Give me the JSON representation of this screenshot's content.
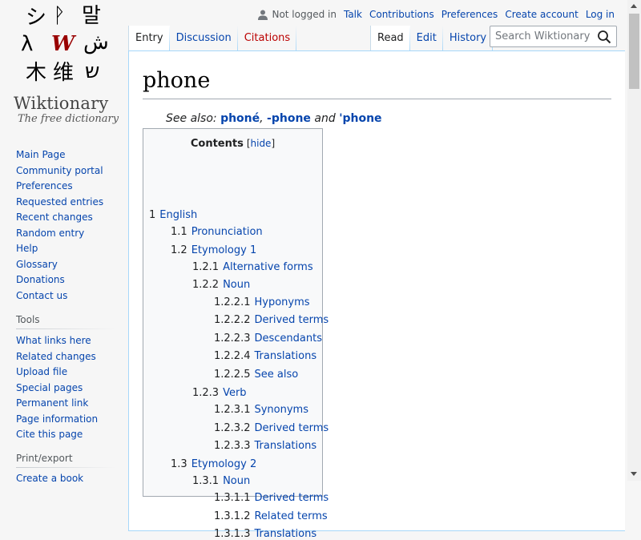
{
  "logo": {
    "glyphs": [
      "シ",
      "ᚹ",
      "말",
      "λ",
      "W",
      "ش",
      "木",
      "维",
      "ש"
    ],
    "title": "Wiktionary",
    "tagline": "The free dictionary"
  },
  "sidebar": {
    "navigation": [
      "Main Page",
      "Community portal",
      "Preferences",
      "Requested entries",
      "Recent changes",
      "Random entry",
      "Help",
      "Glossary",
      "Donations",
      "Contact us"
    ],
    "tools_heading": "Tools",
    "tools": [
      "What links here",
      "Related changes",
      "Upload file",
      "Special pages",
      "Permanent link",
      "Page information",
      "Cite this page"
    ],
    "print_heading": "Print/export",
    "print": [
      "Create a book"
    ]
  },
  "personal": {
    "not_logged_in": "Not logged in",
    "links": [
      "Talk",
      "Contributions",
      "Preferences",
      "Create account",
      "Log in"
    ]
  },
  "tabs": {
    "left": [
      {
        "label": "Entry",
        "selected": true
      },
      {
        "label": "Discussion",
        "selected": false
      },
      {
        "label": "Citations",
        "selected": false,
        "new": true
      }
    ],
    "right": [
      {
        "label": "Read",
        "selected": true
      },
      {
        "label": "Edit",
        "selected": false
      },
      {
        "label": "History",
        "selected": false
      }
    ]
  },
  "search": {
    "placeholder": "Search Wiktionary",
    "icon": "search-icon"
  },
  "page": {
    "title": "phone",
    "see_also": {
      "prefix": "See also: ",
      "links": [
        "phoné",
        "-phone",
        "'phone"
      ],
      "sep1": ", ",
      "sep2": " and "
    }
  },
  "toc": {
    "title": "Contents",
    "toggle_open": "[",
    "toggle_label": "hide",
    "toggle_close": "]",
    "items": [
      {
        "num": "1",
        "text": "English",
        "level": 1
      },
      {
        "num": "1.1",
        "text": "Pronunciation",
        "level": 2
      },
      {
        "num": "1.2",
        "text": "Etymology 1",
        "level": 2
      },
      {
        "num": "1.2.1",
        "text": "Alternative forms",
        "level": 3
      },
      {
        "num": "1.2.2",
        "text": "Noun",
        "level": 3
      },
      {
        "num": "1.2.2.1",
        "text": "Hyponyms",
        "level": 4
      },
      {
        "num": "1.2.2.2",
        "text": "Derived terms",
        "level": 4
      },
      {
        "num": "1.2.2.3",
        "text": "Descendants",
        "level": 4
      },
      {
        "num": "1.2.2.4",
        "text": "Translations",
        "level": 4
      },
      {
        "num": "1.2.2.5",
        "text": "See also",
        "level": 4
      },
      {
        "num": "1.2.3",
        "text": "Verb",
        "level": 3
      },
      {
        "num": "1.2.3.1",
        "text": "Synonyms",
        "level": 4
      },
      {
        "num": "1.2.3.2",
        "text": "Derived terms",
        "level": 4
      },
      {
        "num": "1.2.3.3",
        "text": "Translations",
        "level": 4
      },
      {
        "num": "1.3",
        "text": "Etymology 2",
        "level": 2
      },
      {
        "num": "1.3.1",
        "text": "Noun",
        "level": 3
      },
      {
        "num": "1.3.1.1",
        "text": "Derived terms",
        "level": 4
      },
      {
        "num": "1.3.1.2",
        "text": "Related terms",
        "level": 4
      },
      {
        "num": "1.3.1.3",
        "text": "Translations",
        "level": 4
      }
    ]
  },
  "colors": {
    "link": "#0645ad",
    "new_link": "#ba0000",
    "tab_border": "#a7d7f9",
    "sidebar_bg": "#f6f6f6"
  }
}
